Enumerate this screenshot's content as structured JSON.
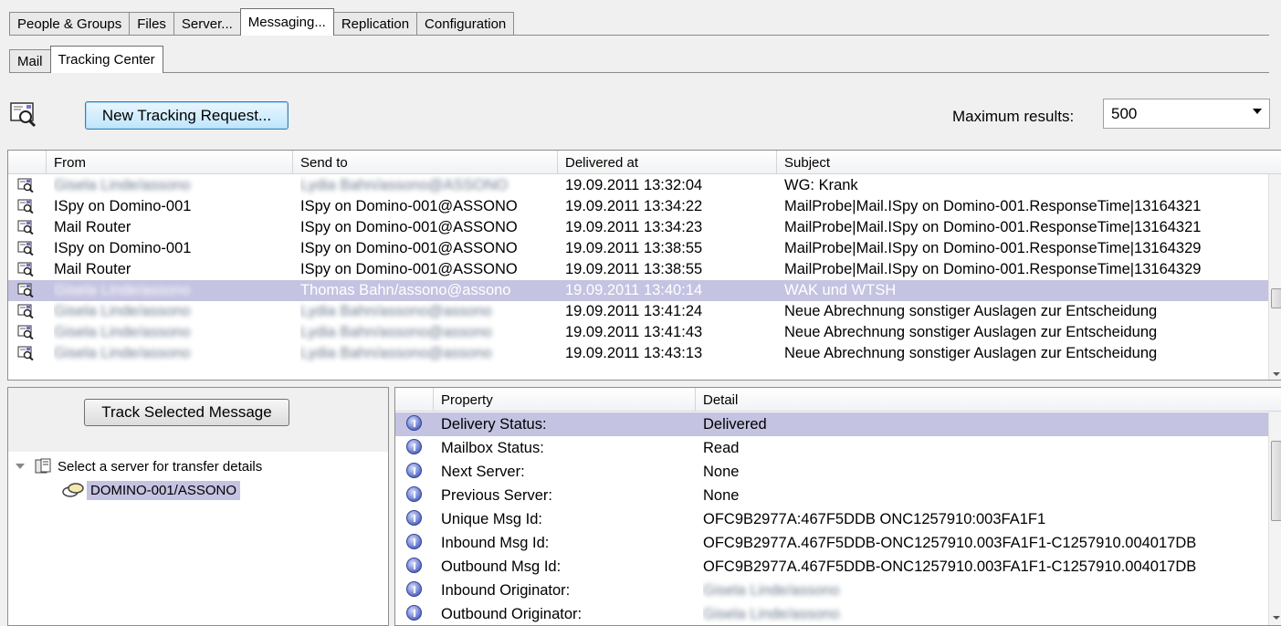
{
  "tabs_main": [
    {
      "label": "People & Groups",
      "active": false
    },
    {
      "label": "Files",
      "active": false
    },
    {
      "label": "Server...",
      "active": false
    },
    {
      "label": "Messaging...",
      "active": true
    },
    {
      "label": "Replication",
      "active": false
    },
    {
      "label": "Configuration",
      "active": false
    }
  ],
  "tabs_sub": [
    {
      "label": "Mail",
      "active": false
    },
    {
      "label": "Tracking Center",
      "active": true
    }
  ],
  "toolbar": {
    "new_request_label": "New Tracking Request...",
    "max_results_label": "Maximum results:",
    "max_results_value": "500"
  },
  "messages": {
    "columns": [
      "From",
      "Send to",
      "Delivered at",
      "Subject"
    ],
    "rows": [
      {
        "from": "Gisela Linde/assono",
        "to": "Lydia Bahn/assono@ASSONO",
        "delivered": "19.09.2011 13:32:04",
        "subject": "WG: Krank",
        "from_blurred": true,
        "to_blurred": true,
        "selected": false
      },
      {
        "from": "ISpy on Domino-001",
        "to": "ISpy on Domino-001@ASSONO",
        "delivered": "19.09.2011 13:34:22",
        "subject": "MailProbe|Mail.ISpy on Domino-001.ResponseTime|13164321",
        "from_blurred": false,
        "to_blurred": false,
        "selected": false
      },
      {
        "from": "Mail Router",
        "to": "ISpy on Domino-001@ASSONO",
        "delivered": "19.09.2011 13:34:23",
        "subject": "MailProbe|Mail.ISpy on Domino-001.ResponseTime|13164321",
        "from_blurred": false,
        "to_blurred": false,
        "selected": false
      },
      {
        "from": "ISpy on Domino-001",
        "to": "ISpy on Domino-001@ASSONO",
        "delivered": "19.09.2011 13:38:55",
        "subject": "MailProbe|Mail.ISpy on Domino-001.ResponseTime|13164329",
        "from_blurred": false,
        "to_blurred": false,
        "selected": false
      },
      {
        "from": "Mail Router",
        "to": "ISpy on Domino-001@ASSONO",
        "delivered": "19.09.2011 13:38:55",
        "subject": "MailProbe|Mail.ISpy on Domino-001.ResponseTime|13164329",
        "from_blurred": false,
        "to_blurred": false,
        "selected": false
      },
      {
        "from": "Gisela Linde/assono",
        "to": "Thomas Bahn/assono@assono",
        "delivered": "19.09.2011 13:40:14",
        "subject": "WAK und WTSH",
        "from_blurred": true,
        "to_blurred": false,
        "selected": true
      },
      {
        "from": "Gisela Linde/assono",
        "to": "Lydia Bahn/assono@assono",
        "delivered": "19.09.2011 13:41:24",
        "subject": "Neue Abrechnung sonstiger Auslagen zur Entscheidung",
        "from_blurred": true,
        "to_blurred": true,
        "selected": false
      },
      {
        "from": "Gisela Linde/assono",
        "to": "Lydia Bahn/assono@assono",
        "delivered": "19.09.2011 13:41:43",
        "subject": "Neue Abrechnung sonstiger Auslagen zur Entscheidung",
        "from_blurred": true,
        "to_blurred": true,
        "selected": false
      },
      {
        "from": "Gisela Linde/assono",
        "to": "Lydia Bahn/assono@assono",
        "delivered": "19.09.2011 13:43:13",
        "subject": "Neue Abrechnung sonstiger Auslagen zur Entscheidung",
        "from_blurred": true,
        "to_blurred": true,
        "selected": false
      }
    ]
  },
  "left_panel": {
    "track_button_label": "Track Selected Message",
    "tree_root_label": "Select a server for transfer details",
    "tree_child_label": "DOMINO-001/ASSONO"
  },
  "details": {
    "columns": [
      "Property",
      "Detail"
    ],
    "rows": [
      {
        "property": "Delivery Status:",
        "detail": "Delivered",
        "blurred": false,
        "selected": true
      },
      {
        "property": "Mailbox Status:",
        "detail": "Read",
        "blurred": false,
        "selected": false
      },
      {
        "property": "Next Server:",
        "detail": "None",
        "blurred": false,
        "selected": false
      },
      {
        "property": "Previous Server:",
        "detail": "None",
        "blurred": false,
        "selected": false
      },
      {
        "property": "Unique Msg Id:",
        "detail": "OFC9B2977A:467F5DDB ONC1257910:003FA1F1",
        "blurred": false,
        "selected": false
      },
      {
        "property": "Inbound Msg Id:",
        "detail": "OFC9B2977A.467F5DDB-ONC1257910.003FA1F1-C1257910.004017DB",
        "blurred": false,
        "selected": false
      },
      {
        "property": "Outbound Msg Id:",
        "detail": "OFC9B2977A.467F5DDB-ONC1257910.003FA1F1-C1257910.004017DB",
        "blurred": false,
        "selected": false
      },
      {
        "property": "Inbound Originator:",
        "detail": "Gisela Linde/assono",
        "blurred": true,
        "selected": false
      },
      {
        "property": "Outbound Originator:",
        "detail": "Gisela Linde/assono",
        "blurred": true,
        "selected": false
      }
    ]
  },
  "icons": {
    "tracking": "mail-magnifier-icon",
    "message": "mail-message-icon",
    "info": "info-icon",
    "server": "server-icon",
    "route": "mail-route-icon"
  },
  "colors": {
    "selection": "#c4c3e1",
    "window_bg": "#f0f0f0"
  }
}
